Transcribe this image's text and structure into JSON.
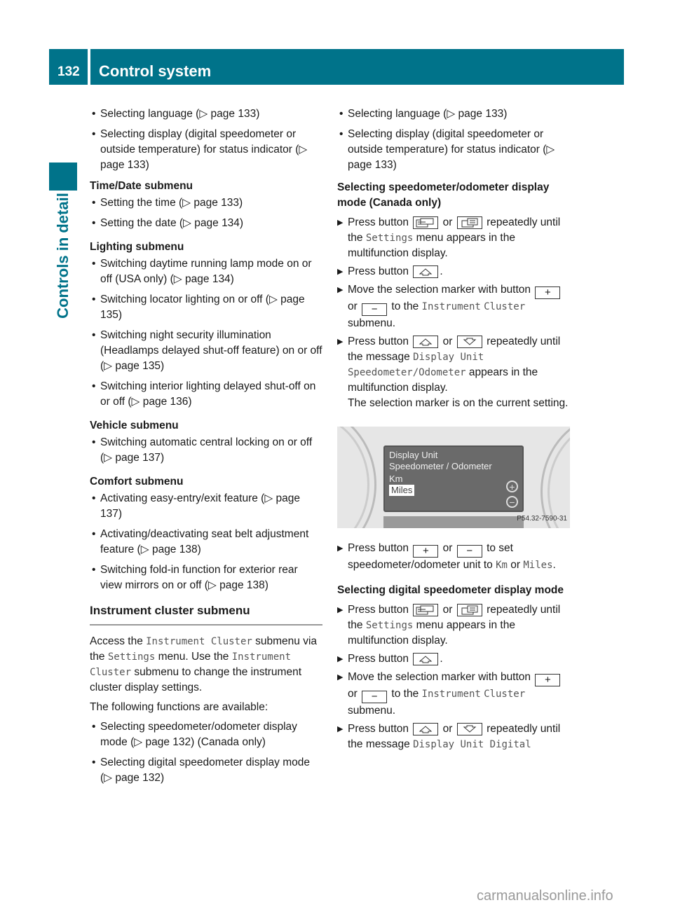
{
  "header": {
    "page_number": "132",
    "title": "Control system"
  },
  "side_tab": "Controls in detail",
  "left": {
    "intro_bullets": [
      "Selecting language (▷ page 133)",
      "Selecting display (digital speedometer or outside temperature) for status indicator (▷ page 133)"
    ],
    "submenus": [
      {
        "title": "Time/Date submenu",
        "items": [
          "Setting the time (▷ page 133)",
          "Setting the date (▷ page 134)"
        ]
      },
      {
        "title": "Lighting submenu",
        "items": [
          "Switching daytime running lamp mode on or off (USA only) (▷ page 134)",
          "Switching locator lighting on or off (▷ page 135)",
          "Switching night security illumination (Headlamps delayed shut-off feature) on or off (▷ page 135)",
          "Switching interior lighting delayed shut-off on or off (▷ page 136)"
        ]
      },
      {
        "title": "Vehicle submenu",
        "items": [
          "Switching automatic central locking on or off (▷ page 137)"
        ]
      },
      {
        "title": "Comfort submenu",
        "items": [
          "Activating easy-entry/exit feature (▷ page 137)",
          "Activating/deactivating seat belt adjustment feature (▷ page 138)",
          "Switching fold-in function for exterior rear view mirrors on or off (▷ page 138)"
        ]
      }
    ],
    "section_title": "Instrument cluster submenu",
    "para1": {
      "t1": "Access the ",
      "m1": "Instrument Cluster",
      "t2": " submenu via the ",
      "m2": "Settings",
      "t3": " menu. Use the ",
      "m3": "Instrument Cluster",
      "t4": " submenu to change the instrument cluster display settings."
    },
    "para2": "The following functions are available:",
    "functions": [
      "Selecting speedometer/odometer display mode (▷ page 132) (Canada only)",
      "Selecting digital speedometer display mode (▷ page 132)"
    ]
  },
  "right": {
    "intro_bullets": [
      "Selecting language (▷ page 133)",
      "Selecting display (digital speedometer or outside temperature) for status indicator (▷ page 133)"
    ],
    "heading1": "Selecting speedometer/odometer display mode (Canada only)",
    "common": {
      "press_button": "Press button",
      "or": "or",
      "repeatedly_until": "repeatedly until",
      "the": "the",
      "settings": "Settings",
      "menu_appears": "menu appears in the multifunction display.",
      "move_marker": "Move the selection marker with button",
      "to_the": "to the",
      "instrument": "Instrument",
      "cluster": "Cluster",
      "submenu": "submenu.",
      "the_message": "the message",
      "plus": "+",
      "minus": "−"
    },
    "s1_msg1": "Display Unit",
    "s1_msg2": "Speedometer/Odometer",
    "s1_appears": "appears in the multifunction display.",
    "s1_note": "The selection marker is on the current setting.",
    "photo": {
      "line1": "Display Unit",
      "line2": "Speedometer / Odometer",
      "option1": "Km",
      "option2": "Miles",
      "code": "P54.32-7590-31"
    },
    "s1_set": {
      "t1": "to set speedometer/odometer unit to ",
      "km": "Km",
      "or": " or ",
      "miles": "Miles",
      "end": "."
    },
    "heading2": "Selecting digital speedometer display mode",
    "s2_msg": "Display Unit Digital"
  },
  "watermark": "carmanualsonline.info"
}
